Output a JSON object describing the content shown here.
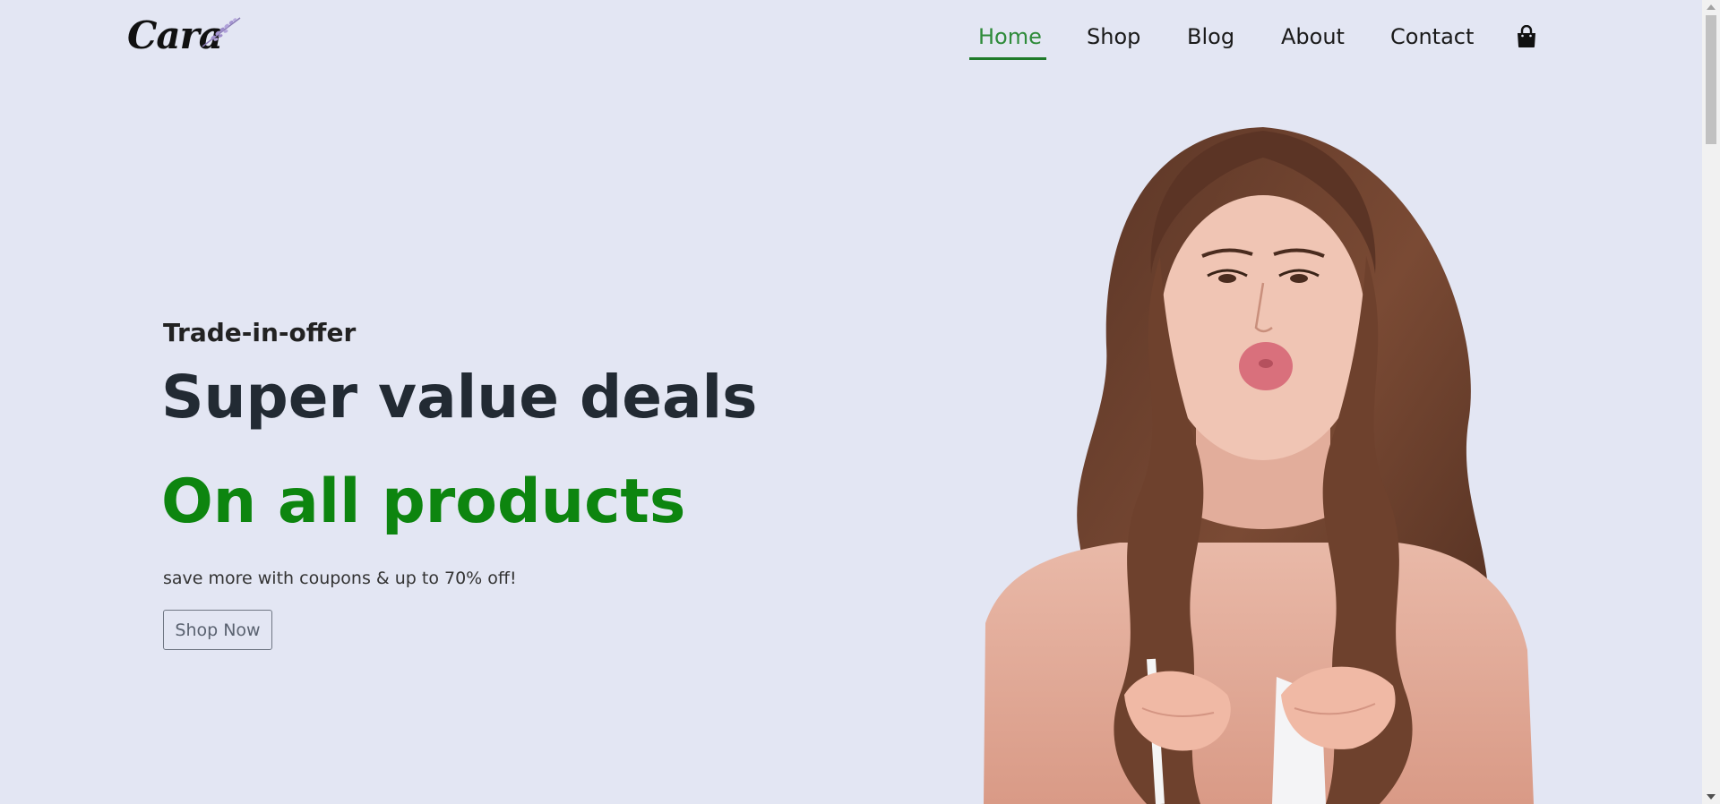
{
  "brand": {
    "logo_text": "Cara"
  },
  "nav": {
    "items": [
      {
        "label": "Home",
        "active": true
      },
      {
        "label": "Shop",
        "active": false
      },
      {
        "label": "Blog",
        "active": false
      },
      {
        "label": "About",
        "active": false
      },
      {
        "label": "Contact",
        "active": false
      }
    ],
    "cart_icon": "shopping-bag-icon"
  },
  "hero": {
    "kicker": "Trade-in-offer",
    "title": "Super value deals",
    "subtitle": "On all products",
    "copy": "save more with coupons & up to 70% off!",
    "cta_label": "Shop Now",
    "image": "woman-blowing-kiss-photo"
  },
  "colors": {
    "background": "#e3e6f3",
    "accent_green": "#0d850f",
    "active_nav": "#2e8b3a",
    "text_dark": "#222a33"
  }
}
